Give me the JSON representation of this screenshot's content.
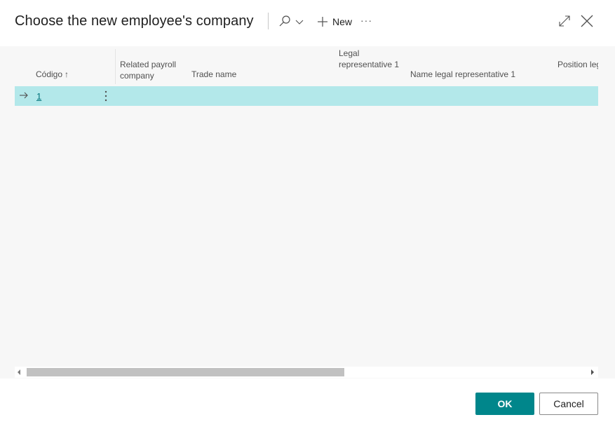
{
  "dialog": {
    "title": "Choose the new employee's company"
  },
  "toolbar": {
    "search_icon": "search-icon",
    "dropdown_icon": "chevron-down-icon",
    "new_label": "New",
    "more_label": "···",
    "expand_icon": "expand-icon",
    "close_icon": "close-icon"
  },
  "grid": {
    "columns": [
      {
        "label": "Código",
        "sort": "ascending"
      },
      {
        "label": "Related payroll company"
      },
      {
        "label": "Trade name"
      },
      {
        "label": "Legal representative 1"
      },
      {
        "label": "Name legal representative 1"
      },
      {
        "label": "Position legal representative"
      }
    ],
    "sort_arrow": "↑",
    "rows": [
      {
        "codigo": "1",
        "related_payroll_company": "",
        "trade_name": "",
        "legal_representative_1": "",
        "name_legal_representative_1": "",
        "position_legal_representative": "",
        "selected": true
      }
    ]
  },
  "footer": {
    "ok_label": "OK",
    "cancel_label": "Cancel"
  },
  "colors": {
    "accent": "#00868b",
    "selected_row": "#b3e8ea",
    "link": "#00727a",
    "content_bg": "#f7f7f7"
  }
}
